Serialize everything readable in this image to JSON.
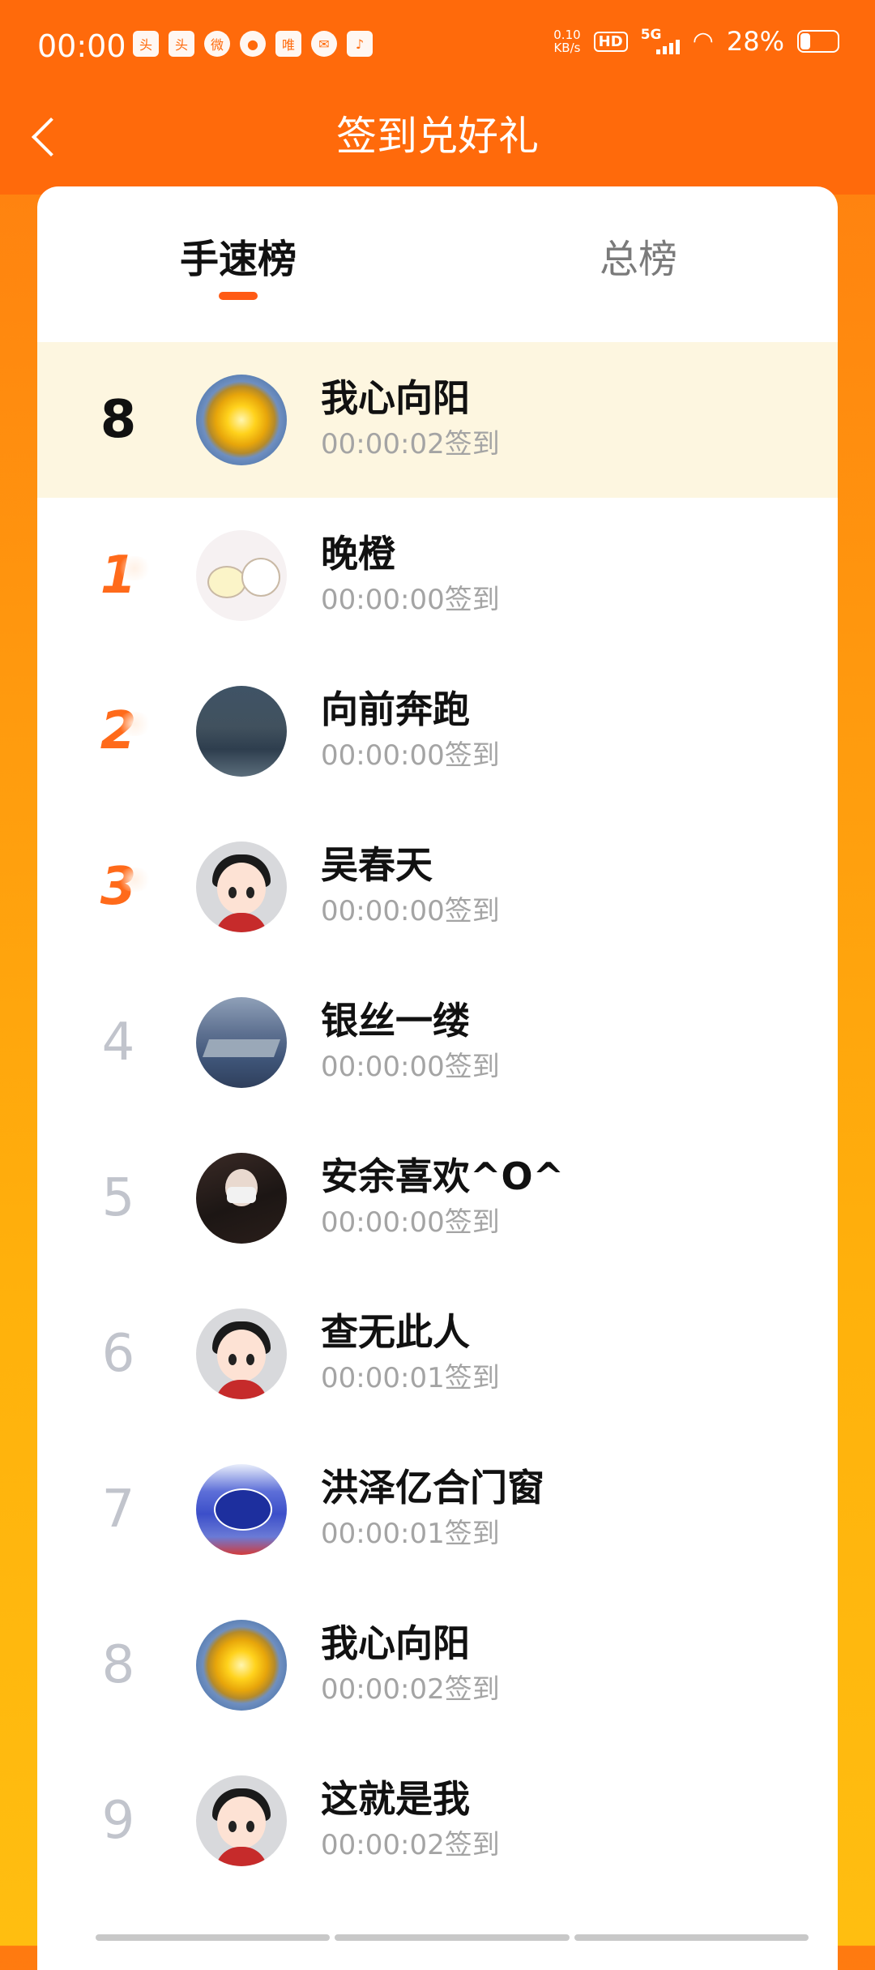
{
  "status_bar": {
    "time": "00:00",
    "app_icons": [
      "toutiao-icon",
      "toutiao-news-icon",
      "weibo-icon",
      "message-icon",
      "vip-icon",
      "wechat-icon",
      "douyin-icon"
    ],
    "net_speed_value": "0.10",
    "net_speed_unit": "KB/s",
    "hd_label": "HD",
    "network_label": "5G",
    "battery_percent": "28%"
  },
  "header": {
    "title": "签到兑好礼"
  },
  "tabs": [
    {
      "label": "手速榜",
      "active": true
    },
    {
      "label": "总榜",
      "active": false
    }
  ],
  "my_rank": {
    "rank": "8",
    "name": "我心向阳",
    "time": "00:00:02签到"
  },
  "ranking": [
    {
      "rank": "1",
      "name": "晚橙",
      "time": "00:00:00签到"
    },
    {
      "rank": "2",
      "name": "向前奔跑",
      "time": "00:00:00签到"
    },
    {
      "rank": "3",
      "name": "吴春天",
      "time": "00:00:00签到"
    },
    {
      "rank": "4",
      "name": "银丝一缕",
      "time": "00:00:00签到"
    },
    {
      "rank": "5",
      "name": "安余喜欢^O^",
      "time": "00:00:00签到"
    },
    {
      "rank": "6",
      "name": "查无此人",
      "time": "00:00:01签到"
    },
    {
      "rank": "7",
      "name": "洪泽亿合门窗",
      "time": "00:00:01签到"
    },
    {
      "rank": "8",
      "name": "我心向阳",
      "time": "00:00:02签到"
    },
    {
      "rank": "9",
      "name": "这就是我",
      "time": "00:00:02签到"
    }
  ],
  "colors": {
    "header_bg": "#ff6a0b",
    "accent": "#ff5a14",
    "top_rank": "#ff6a1a",
    "highlight_row": "#fdf6e0"
  }
}
